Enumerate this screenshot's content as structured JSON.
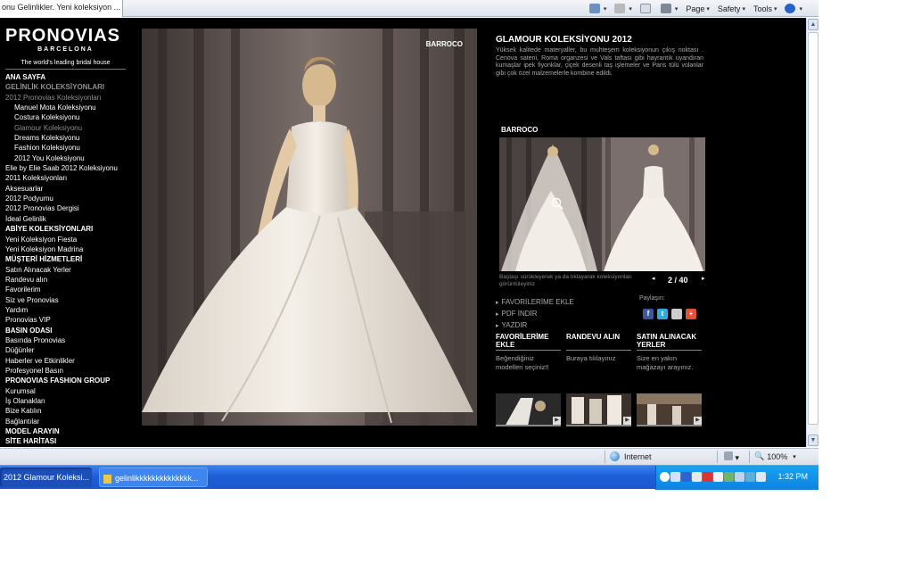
{
  "browser": {
    "tab_title": "onu Gelinlikler. Yeni koleksiyon ...",
    "commands": {
      "page": "Page",
      "safety": "Safety",
      "tools": "Tools"
    }
  },
  "site": {
    "logo": {
      "name": "PRONOVIAS",
      "city": "BARCELONA",
      "tagline": "The world's leading bridal house"
    },
    "nav": [
      {
        "label": "ANA SAYFA",
        "style": "h"
      },
      {
        "label": "GELİNLİK KOLEKSİYONLARI",
        "style": "h g"
      },
      {
        "label": "2012 Pronovias Koleksiyonları",
        "style": "g"
      },
      {
        "label": "Manuel Mota Koleksiyonu",
        "style": "i"
      },
      {
        "label": "Costura Koleksiyonu",
        "style": "i"
      },
      {
        "label": "Glamour Koleksiyonu",
        "style": "i g"
      },
      {
        "label": "Dreams Koleksiyonu",
        "style": "i"
      },
      {
        "label": "Fashion Koleksiyonu",
        "style": "i"
      },
      {
        "label": "2012 You Koleksiyonu",
        "style": "i"
      },
      {
        "label": "Elie by Elie Saab 2012 Koleksiyonu",
        "style": ""
      },
      {
        "label": "2011 Koleksiyonları",
        "style": ""
      },
      {
        "label": "Aksesuarlar",
        "style": ""
      },
      {
        "label": "2012 Podyumu",
        "style": ""
      },
      {
        "label": "2012 Pronovias Dergisi",
        "style": ""
      },
      {
        "label": "İdeal Gelinlik",
        "style": ""
      },
      {
        "label": "ABİYE KOLEKSİYONLARI",
        "style": "h"
      },
      {
        "label": "Yeni Koleksiyon Fiesta",
        "style": ""
      },
      {
        "label": "Yeni Koleksiyon Madrina",
        "style": ""
      },
      {
        "label": "MÜŞTERİ HİZMETLERİ",
        "style": "h"
      },
      {
        "label": "Satın Alınacak Yerler",
        "style": ""
      },
      {
        "label": "Randevu alın",
        "style": ""
      },
      {
        "label": "Favorilerim",
        "style": ""
      },
      {
        "label": "Siz ve Pronovias",
        "style": ""
      },
      {
        "label": "Yardım",
        "style": ""
      },
      {
        "label": "Pronovias VIP",
        "style": ""
      },
      {
        "label": "BASIN ODASI",
        "style": "h"
      },
      {
        "label": "Basında Pronovias",
        "style": ""
      },
      {
        "label": "Düğünler",
        "style": ""
      },
      {
        "label": "Haberler ve Etkinlikler",
        "style": ""
      },
      {
        "label": "Profesyonel Basın",
        "style": ""
      },
      {
        "label": "PRONOVIAS FASHION GROUP",
        "style": "h"
      },
      {
        "label": "Kurumsal",
        "style": ""
      },
      {
        "label": "İş Olanakları",
        "style": ""
      },
      {
        "label": "Bize Katılın",
        "style": ""
      },
      {
        "label": "Bağlantılar",
        "style": ""
      },
      {
        "label": "MODEL ARAYIN",
        "style": "h"
      },
      {
        "label": "SİTE HARİTASI",
        "style": "h"
      }
    ],
    "main_photo_label": "BARROCO",
    "collection": {
      "title": "GLAMOUR KOLEKSİYONU 2012",
      "description": "Yüksek kalitede materyaller, bu muhteşem koleksiyonun çıkış noktası . Cenova sateni, Roma organzesi ve Vals taftası gibi hayrantık uyandıran kumaşlar ipek fiyonklar, çiçek desenli taş işlemeler ve Paris tülü volanlar gibi çok özel malzemelerle kombine edildi."
    },
    "gallery": {
      "label": "BARROCO",
      "hint": "Baştaşı sürükleyerek ya da tıklayarak koleksiyonları görüntüleyiniz",
      "prev": "◂",
      "next": "▸",
      "counter": "2 / 40"
    },
    "links": [
      "FAVORİLERİME EKLE",
      "PDF İNDİR",
      "YAZDIR"
    ],
    "share": {
      "label": "Paylaşın:",
      "icons": [
        "f",
        "t",
        "",
        "+"
      ],
      "colors": [
        "#3b5998",
        "#33aadd",
        "#cccccc",
        "#e0533a"
      ]
    },
    "columns": [
      {
        "title": "FAVORİLERİME EKLE",
        "desc": "Beğendiğiniz modelleri seçiniz!!"
      },
      {
        "title": "RANDEVU ALIN",
        "desc": "Buraya tıklayınız"
      },
      {
        "title": "SATIN ALINACAK YERLER",
        "desc": "Size en yakın mağazayı arayınız."
      }
    ]
  },
  "statusbar": {
    "zone": "Internet",
    "zoom": "100%"
  },
  "taskbar": {
    "items": [
      "2012 Glamour Koleksi...",
      "gelinlikkkkkkkkkkkkkk..."
    ],
    "clock": "1:32 PM"
  }
}
